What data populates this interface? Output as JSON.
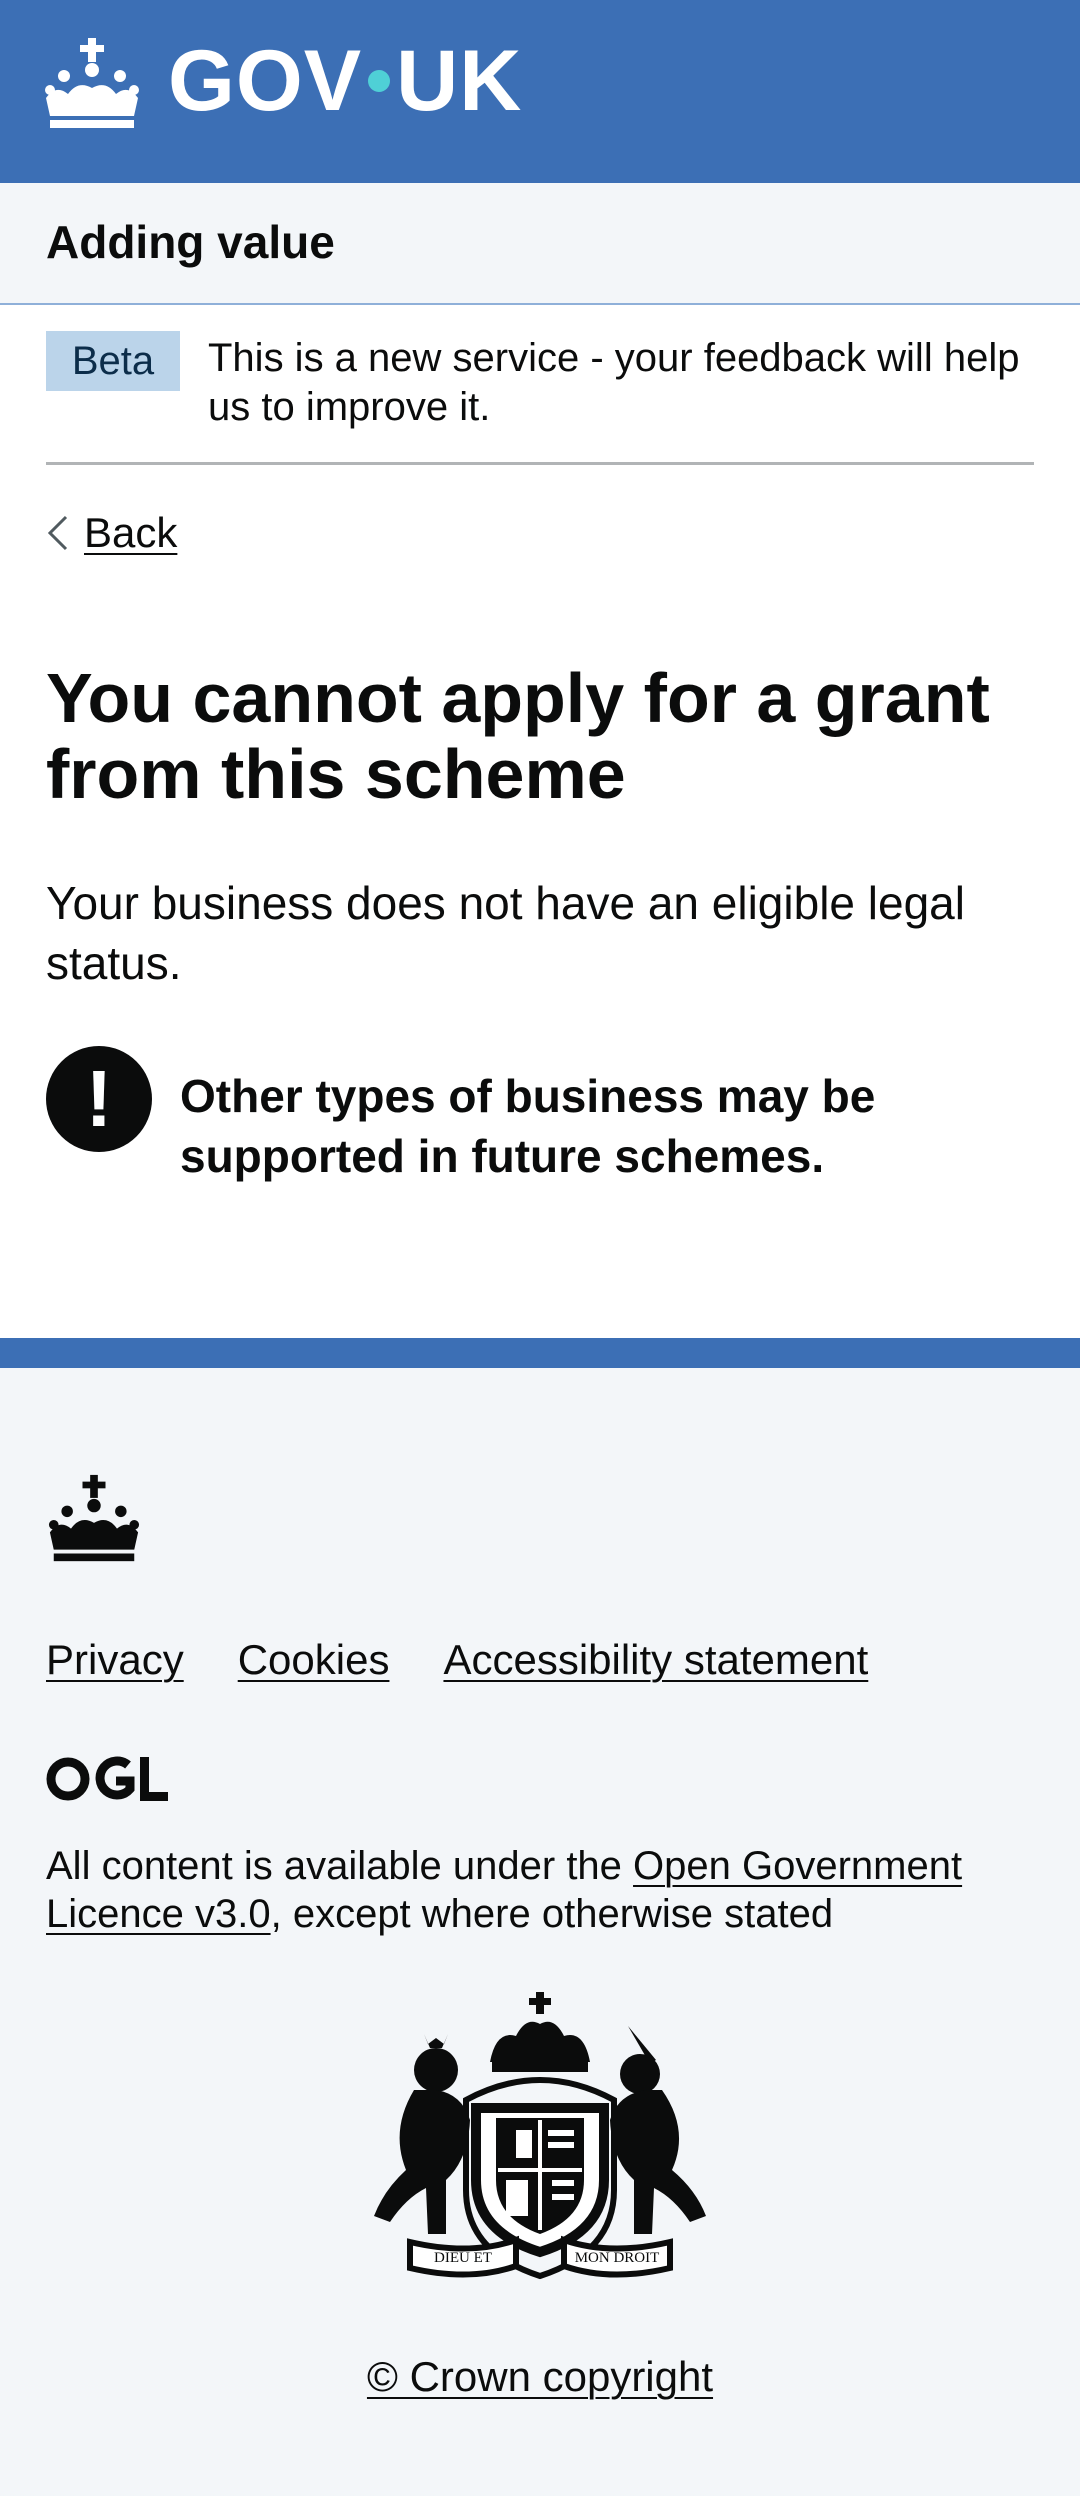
{
  "header": {
    "logo_left": "GOV",
    "logo_right": "UK",
    "logo_icon": "crown-icon"
  },
  "service": {
    "name": "Adding value"
  },
  "phase_banner": {
    "tag": "Beta",
    "text": "This is a new service - your feedback will help us to improve it."
  },
  "back_link": {
    "label": "Back",
    "icon": "chevron-left-icon"
  },
  "main": {
    "title": "You cannot apply for a grant from this scheme",
    "body": "Your business does not have an eligible legal status.",
    "warning": {
      "icon_glyph": "!",
      "text": "Other types of business may be supported in future schemes."
    }
  },
  "footer": {
    "links": [
      "Privacy",
      "Cookies",
      "Accessibility statement"
    ],
    "ogl_logo": "OGL",
    "licence_prefix": "All content is available under the ",
    "licence_link": "Open Government Licence v3.0",
    "licence_suffix": ", except where otherwise stated",
    "copyright": "© Crown copyright",
    "arms_mottos": [
      "DIEU ET",
      "MON DROIT"
    ]
  },
  "colors": {
    "header_blue": "#3c6fb5",
    "footer_bg": "#f3f6f9",
    "beta_tag_bg": "#bbd4ea",
    "text": "#0b0c0c"
  }
}
